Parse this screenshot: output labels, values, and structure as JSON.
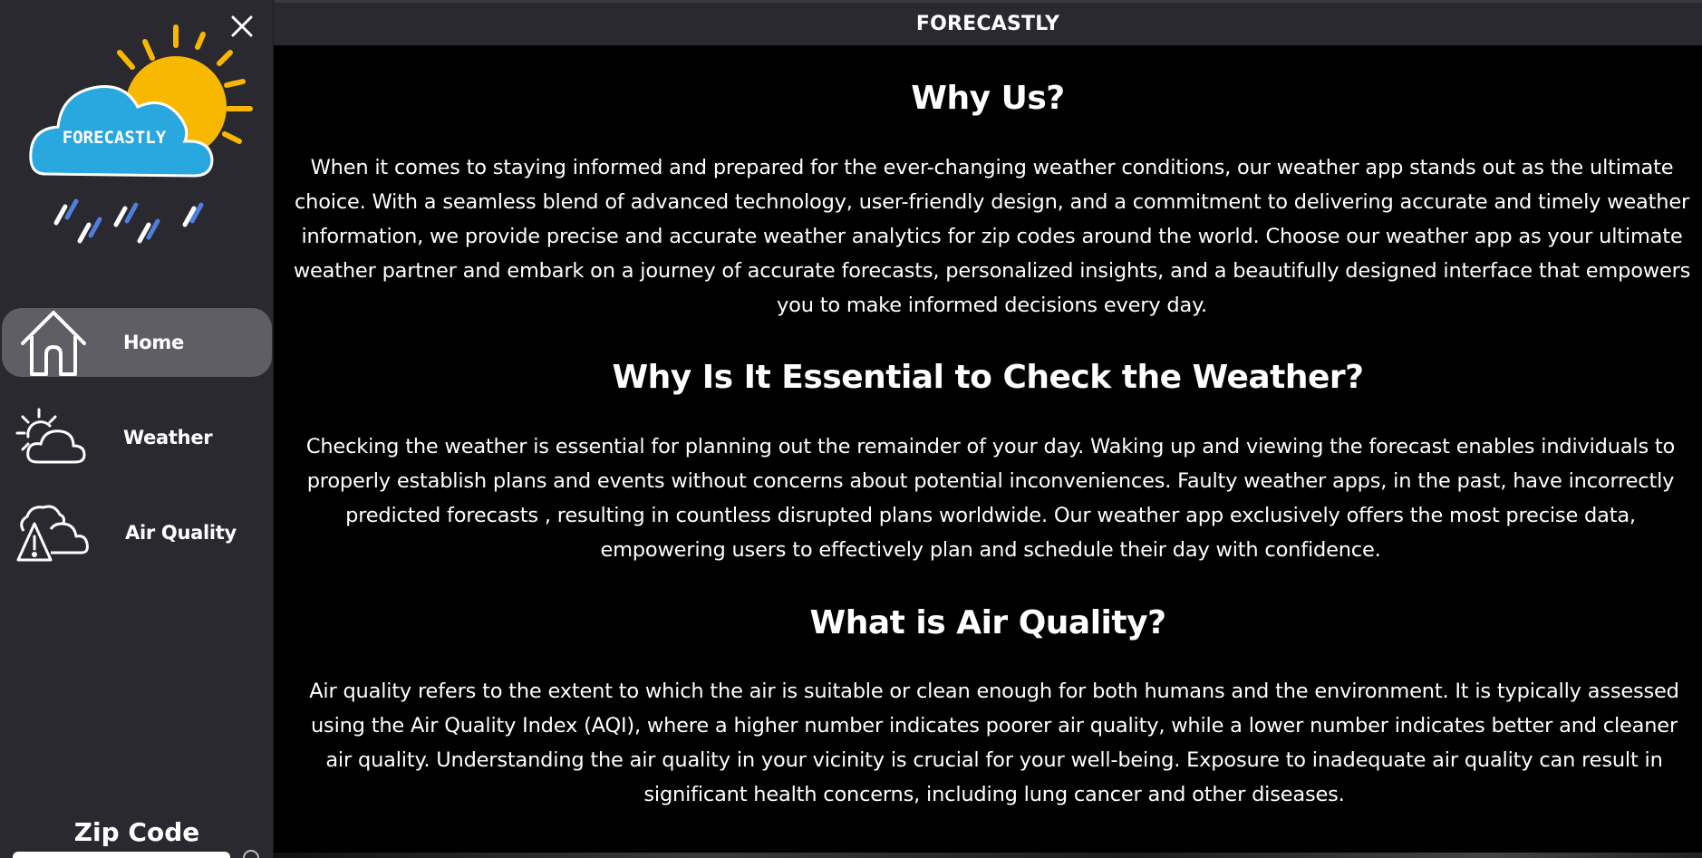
{
  "app": {
    "title": "FORECASTLY",
    "logo_text": "FORECASTLY"
  },
  "sidebar": {
    "close_icon": "close-icon",
    "items": [
      {
        "label": "Home",
        "icon": "home-icon",
        "active": true
      },
      {
        "label": "Weather",
        "icon": "sun-cloud-icon",
        "active": false
      },
      {
        "label": "Air Quality",
        "icon": "cloud-warning-icon",
        "active": false
      }
    ],
    "zip_label": "Zip Code"
  },
  "sections": [
    {
      "title": "Why Us?",
      "body": "When it comes to staying informed and prepared for the ever-changing weather conditions, our weather app stands out as the ultimate choice. With a seamless blend of advanced technology, user-friendly design, and a commitment to delivering accurate and timely weather information, we provide precise and accurate weather analytics for zip codes around the world. Choose our weather app as your ultimate weather partner and embark on a journey of accurate forecasts, personalized insights, and a beautifully designed interface that empowers you to make informed decisions every day."
    },
    {
      "title": "Why Is It Essential to Check the Weather?",
      "body": "Checking the weather is essential for planning out the remainder of your day. Waking up and viewing the forecast enables individuals to properly establish plans and events without concerns about potential inconveniences. Faulty weather apps, in the past, have incorrectly predicted forecasts , resulting in countless disrupted plans worldwide. Our weather app exclusively offers the most precise data, empowering users to effectively plan and schedule their day with confidence."
    },
    {
      "title": "What is Air Quality?",
      "body": "Air quality refers to the extent to which the air is suitable or clean enough for both humans and the environment. It is typically assessed using the Air Quality Index (AQI), where a higher number indicates poorer air quality, while a lower number indicates better and cleaner air quality. Understanding the air quality in your vicinity is crucial for your well-being. Exposure to inadequate air quality can result in significant health concerns, including lung cancer and other diseases."
    }
  ],
  "colors": {
    "sidebar_bg": "#2a292f",
    "active_item_bg": "#5f5e64",
    "main_bg": "#000000",
    "logo_cloud": "#29a8e0",
    "logo_sun": "#f9b800",
    "logo_rain": "#4f7fdc"
  }
}
